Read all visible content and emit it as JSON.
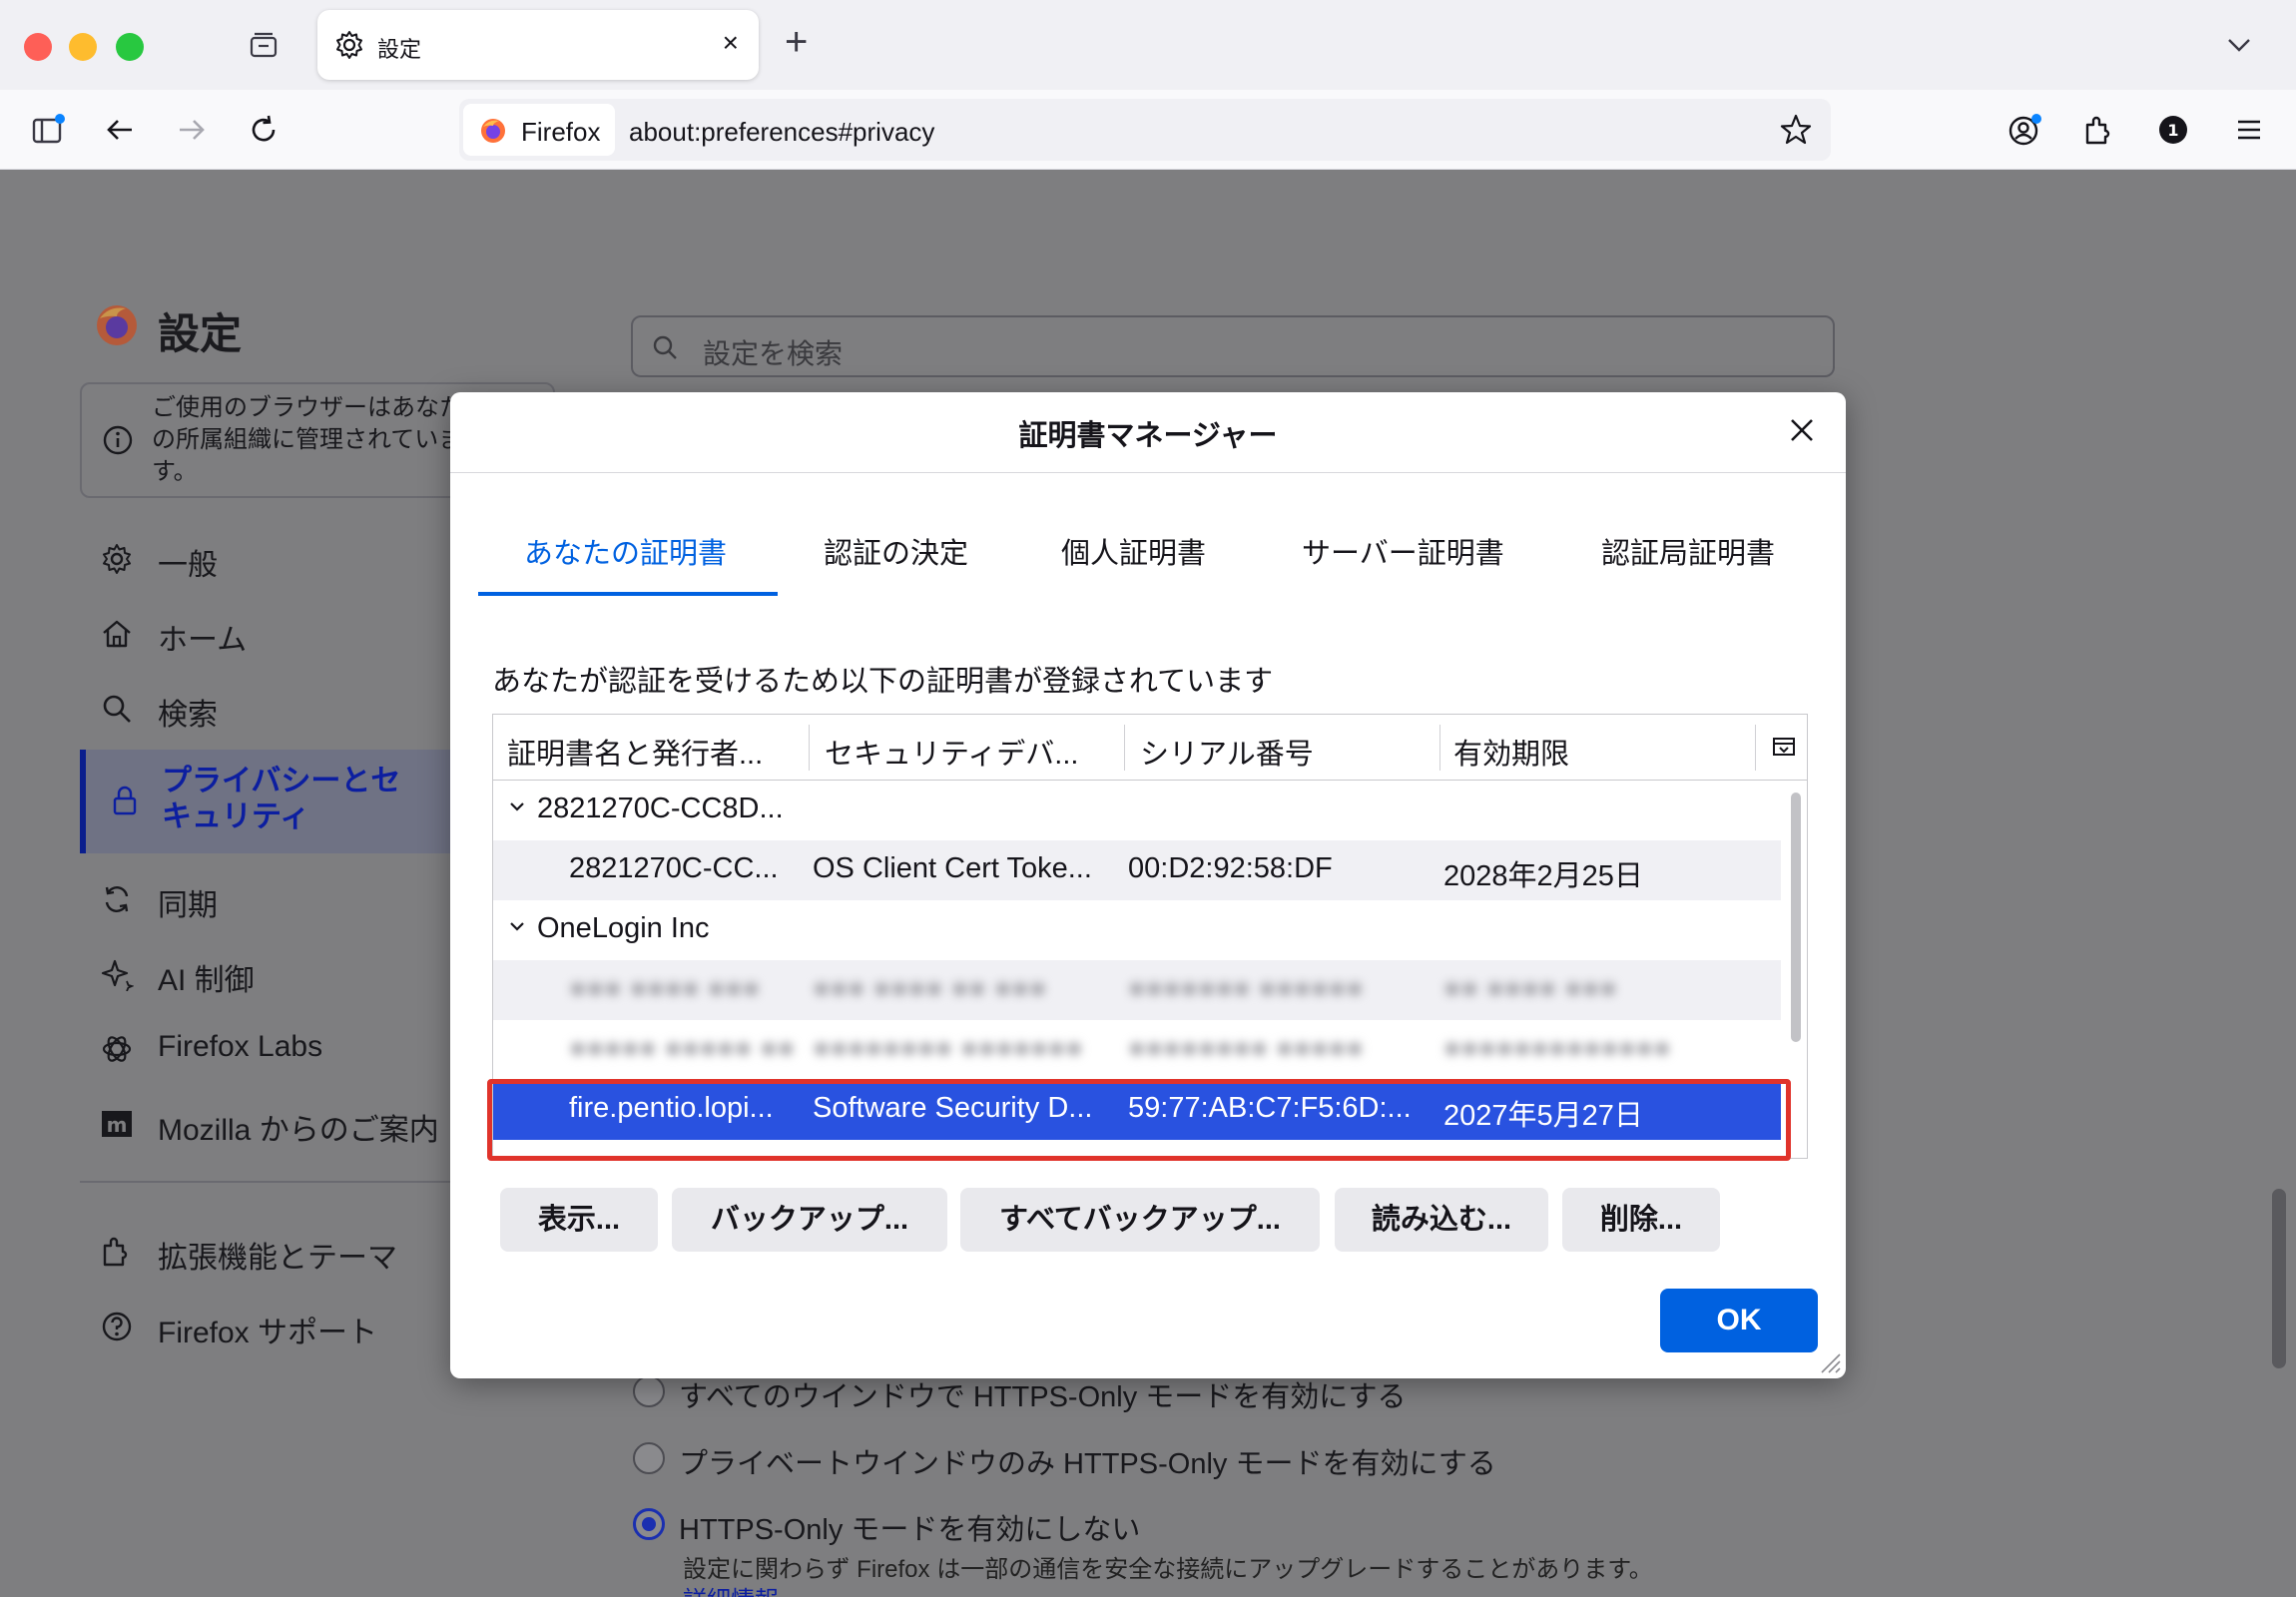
{
  "browser": {
    "tab": {
      "title": "設定",
      "close": "×"
    },
    "new_tab": "+",
    "identity_label": "Firefox",
    "url": "about:preferences#privacy"
  },
  "settings_page": {
    "title": "設定",
    "search_placeholder": "設定を検索",
    "managed_notice": "ご使用のブラウザーはあなたの所属組織に管理されています。",
    "categories": [
      {
        "label": "一般",
        "icon": "gear-icon"
      },
      {
        "label": "ホーム",
        "icon": "home-icon"
      },
      {
        "label": "検索",
        "icon": "search-icon"
      },
      {
        "label": "プライバシーとセキュリティ",
        "icon": "lock-icon",
        "selected": true
      },
      {
        "label": "同期",
        "icon": "sync-icon"
      },
      {
        "label": "AI 制御",
        "icon": "sparkle-icon"
      },
      {
        "label": "Firefox Labs",
        "icon": "labs-icon"
      },
      {
        "label": "Mozilla からのご案内",
        "icon": "mozilla-icon"
      }
    ],
    "footer_items": [
      {
        "label": "拡張機能とテーマ",
        "icon": "puzzle-icon"
      },
      {
        "label": "Firefox サポート",
        "icon": "help-icon"
      }
    ],
    "https_only": {
      "options": [
        {
          "label": "すべてのウインドウで HTTPS-Only モードを有効にする",
          "checked": false
        },
        {
          "label": "プライベートウインドウのみ HTTPS-Only モードを有効にする",
          "checked": false
        },
        {
          "label": "HTTPS-Only モードを有効にしない",
          "checked": true
        }
      ],
      "note": "設定に関わらず Firefox は一部の通信を安全な接続にアップグレードすることがあります。",
      "more_link": "詳細情報"
    }
  },
  "dialog": {
    "title": "証明書マネージャー",
    "tabs": [
      {
        "label": "あなたの証明書",
        "active": true
      },
      {
        "label": "認証の決定",
        "active": false
      },
      {
        "label": "個人証明書",
        "active": false
      },
      {
        "label": "サーバー証明書",
        "active": false
      },
      {
        "label": "認証局証明書",
        "active": false
      }
    ],
    "description": "あなたが認証を受けるため以下の証明書が登録されています",
    "columns": [
      "証明書名と発行者...",
      "セキュリティデバ...",
      "シリアル番号",
      "有効期限"
    ],
    "groups": [
      {
        "name": "2821270C-CC8D...",
        "rows": [
          {
            "name": "2821270C-CC...",
            "device": "OS Client Cert Toke...",
            "serial": "00:D2:92:58:DF",
            "expires": "2028年2月25日"
          }
        ]
      },
      {
        "name": "OneLogin Inc",
        "rows": [
          {
            "name": "●●● ●●●● ●●●",
            "device": "●●● ●●●● ●● ●●●",
            "serial": "●●●●●●● ●●●●●●",
            "expires": "●● ●●●● ●●●",
            "redacted": true
          },
          {
            "name": "●●●●● ●●●●● ●●",
            "device": "●●●●●●●● ●●●●●●●",
            "serial": "●●●●●●●● ●●●●●",
            "expires": "●●●●●●●●●●●●●",
            "redacted": true
          },
          {
            "name": "fire.pentio.lopi...",
            "device": "Software Security D...",
            "serial": "59:77:AB:C7:F5:6D:...",
            "expires": "2027年5月27日",
            "selected": true
          }
        ]
      }
    ],
    "buttons": [
      "表示...",
      "バックアップ...",
      "すべてバックアップ...",
      "読み込む...",
      "削除..."
    ],
    "ok": "OK",
    "colors": {
      "accent": "#0061e0",
      "selection": "#2952e0",
      "highlight_border": "#e0332b"
    }
  }
}
